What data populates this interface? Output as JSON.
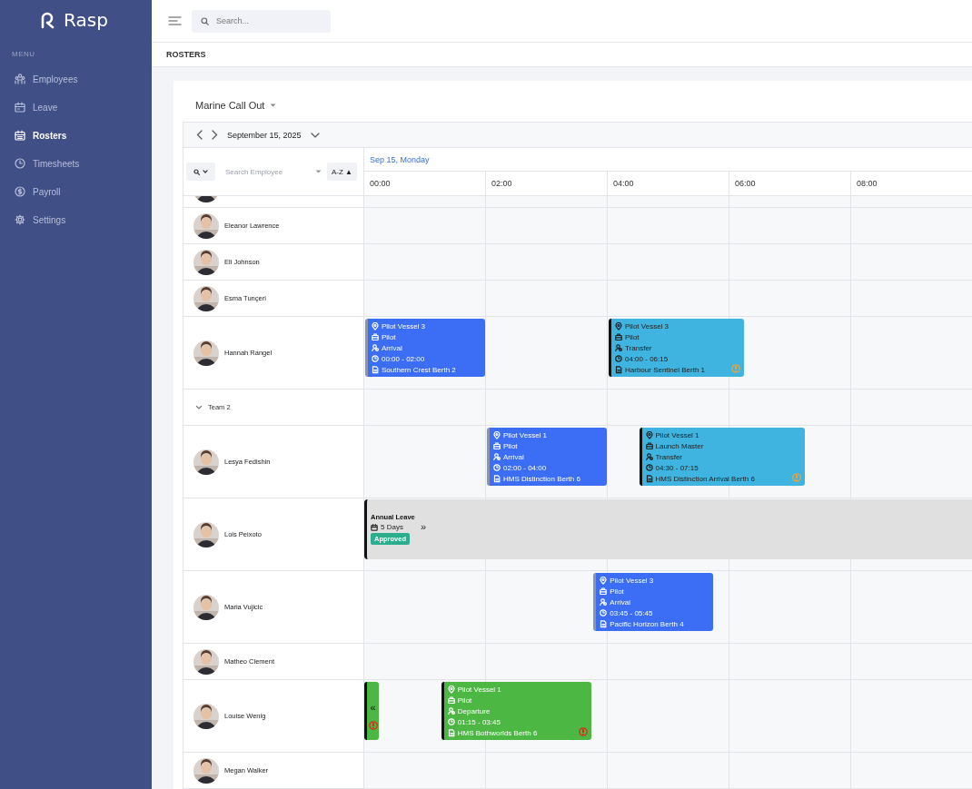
{
  "sidebar": {
    "logo": "Rasp",
    "section": "MENU",
    "items": [
      {
        "label": "Employees",
        "selected": false
      },
      {
        "label": "Leave",
        "selected": false
      },
      {
        "label": "Rosters",
        "selected": true
      },
      {
        "label": "Timesheets",
        "selected": false
      },
      {
        "label": "Payroll",
        "selected": false
      },
      {
        "label": "Settings",
        "selected": false
      }
    ]
  },
  "topbar": {
    "search": {
      "placeholder": "Search..."
    }
  },
  "page_title": "ROSTERS",
  "roster": {
    "title": "Marine Call Out",
    "date": "September 15, 2025",
    "day": "Sep 15, Monday",
    "employee_search": {
      "placeholder": "Search Employee"
    },
    "sort_label": "A-Z",
    "sort_arrow": "▲",
    "hours": [
      "00:00",
      "02:00",
      "04:00",
      "06:00",
      "08:00"
    ],
    "rows": [
      {
        "kind": "partial"
      },
      {
        "kind": "employee",
        "name": "Eleanor Lawrence"
      },
      {
        "kind": "employee",
        "name": "Eli Johnson"
      },
      {
        "kind": "employee",
        "name": "Esma Tunçeri"
      },
      {
        "kind": "employee",
        "name": "Hannah Rangel",
        "events": [
          {
            "kind": "shift",
            "color": "#3b6ef5",
            "dark_edge": false,
            "location": "Pilot Vessel 3",
            "role": "Pilot",
            "type": "Arrival",
            "time": "00:00 - 02:00",
            "berth": "Southern Crest Berth 2"
          },
          {
            "kind": "shift",
            "color": "#3fb4e0",
            "dark_edge": true,
            "warning": {
              "color": "#e8a33a"
            },
            "location": "Pilot Vessel 3",
            "role": "Pilot",
            "type": "Transfer",
            "time": "04:00 - 06:15",
            "berth": "Harbour Sentinel Berth 1"
          }
        ]
      },
      {
        "kind": "group",
        "name": "Team 2",
        "expanded": true
      },
      {
        "kind": "employee",
        "name": "Lesya Fedishin",
        "events": [
          {
            "kind": "shift",
            "color": "#3b6ef5",
            "dark_edge": false,
            "location": "Pilot Vessel 1",
            "role": "Pilot",
            "type": "Arrival",
            "time": "02:00 - 04:00",
            "berth": "HMS Distinction Berth 6"
          },
          {
            "kind": "shift",
            "color": "#3fb4e0",
            "dark_edge": true,
            "warning": {
              "color": "#e8a33a"
            },
            "location": "Pilot Vessel 1",
            "role": "Launch Master",
            "type": "Transfer",
            "time": "04:30 - 07:15",
            "berth": "HMS Distinction Arrival Berth 6"
          }
        ]
      },
      {
        "kind": "employee",
        "name": "Lois Peixoto",
        "events": [
          {
            "kind": "leave",
            "title": "Annual Leave",
            "duration": "5 Days",
            "more": "»",
            "status": "Approved"
          }
        ]
      },
      {
        "kind": "employee",
        "name": "Maria Vujicic",
        "events": [
          {
            "kind": "shift",
            "color": "#3b6ef5",
            "dark_edge": false,
            "location": "Pilot Vessel 3",
            "role": "Pilot",
            "type": "Arrival",
            "time": "03:45 - 05:45",
            "berth": "Pacific Horizon Berth 4"
          }
        ]
      },
      {
        "kind": "employee",
        "name": "Matheo Clement"
      },
      {
        "kind": "employee",
        "name": "Louise Wenig",
        "events": [
          {
            "kind": "continued",
            "color": "#4cb843",
            "dark_edge": true,
            "warning": {
              "color": "#e0281e"
            },
            "arrow": "«"
          },
          {
            "kind": "shift",
            "color": "#4cb843",
            "dark_edge": true,
            "warning": {
              "color": "#e0281e"
            },
            "location": "Pilot Vessel 1",
            "role": "Pilot",
            "type": "Departure",
            "time": "01:15 - 03:45",
            "berth": "HMS Bothworlds Berth 6"
          }
        ]
      },
      {
        "kind": "employee",
        "name": "Megan Walker"
      }
    ]
  }
}
